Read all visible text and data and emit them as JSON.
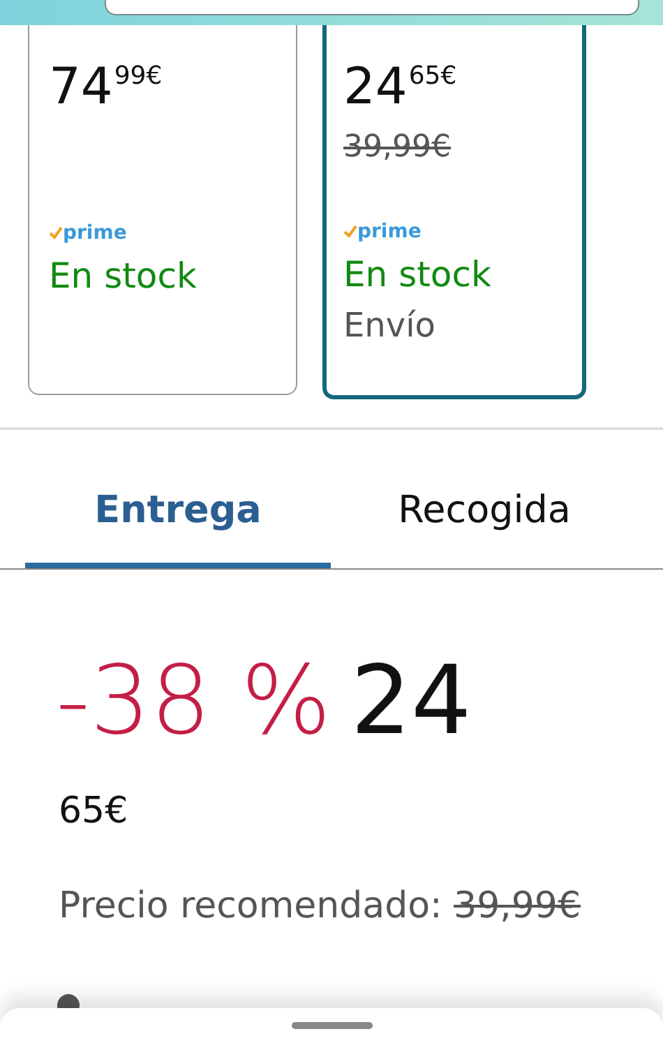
{
  "offers": [
    {
      "price_whole": "74",
      "price_fraction": "99€",
      "badge": "prime",
      "stock": "En stock",
      "selected": false
    },
    {
      "price_whole": "24",
      "price_fraction": "65€",
      "list_price": "39,99€",
      "badge": "prime",
      "stock": "En stock",
      "shipping": "Envío",
      "selected": true
    }
  ],
  "tabs": [
    {
      "label": "Entrega",
      "selected": true
    },
    {
      "label": "Recogida",
      "selected": false
    }
  ],
  "deal": {
    "discount": "-38 %",
    "price_whole": "24",
    "price_fraction": "65€"
  },
  "recommended": {
    "label": "Precio recomendado:",
    "value": "39,99€"
  }
}
